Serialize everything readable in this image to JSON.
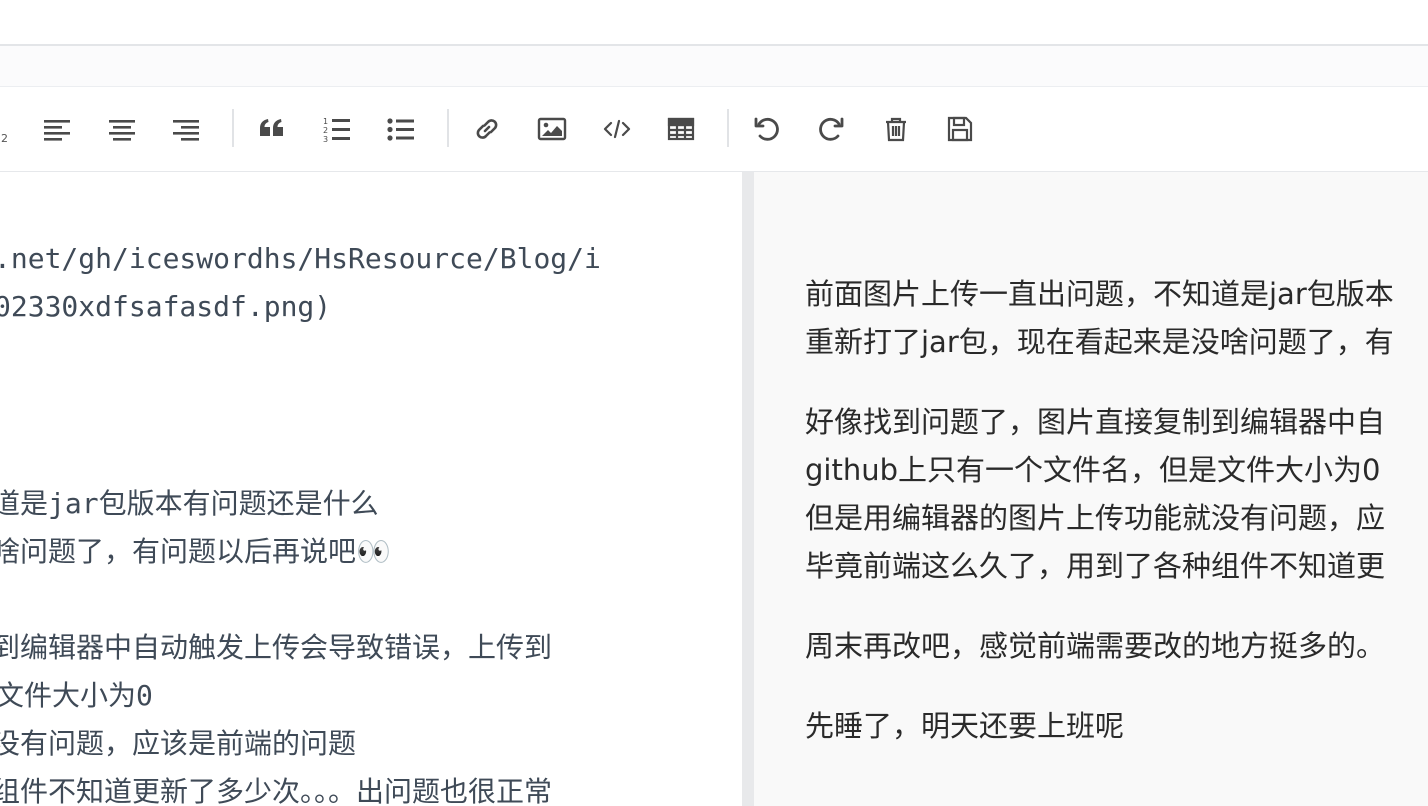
{
  "toolbar": {
    "buttons": [
      {
        "name": "subscript",
        "label": "subscript"
      },
      {
        "name": "align-left",
        "label": "align left"
      },
      {
        "name": "align-center",
        "label": "align center"
      },
      {
        "name": "align-right",
        "label": "align right"
      },
      {
        "name": "quote",
        "label": "quote"
      },
      {
        "name": "ordered-list",
        "label": "ordered list"
      },
      {
        "name": "unordered-list",
        "label": "unordered list"
      },
      {
        "name": "link",
        "label": "link"
      },
      {
        "name": "image",
        "label": "image"
      },
      {
        "name": "code",
        "label": "code"
      },
      {
        "name": "table",
        "label": "table"
      },
      {
        "name": "undo",
        "label": "undo"
      },
      {
        "name": "redo",
        "label": "redo"
      },
      {
        "name": "trash",
        "label": "trash"
      },
      {
        "name": "save",
        "label": "save"
      }
    ]
  },
  "editor": {
    "lines": [
      ".net/gh/iceswordhs/HsResource/Blog/i",
      "02330xdfsafasdf.png)",
      "道是jar包版本有问题还是什么",
      "啥问题了，有问题以后再说吧👀",
      "到编辑器中自动触发上传会导致错误，上传到",
      "文件大小为0",
      "没有问题，应该是前端的问题",
      "组件不知道更新了多少次。。。出问题也很正常"
    ]
  },
  "preview": {
    "paragraphs": [
      "前面图片上传一直出问题，不知道是jar包版本",
      "重新打了jar包，现在看起来是没啥问题了，有",
      "好像找到问题了，图片直接复制到编辑器中自",
      "github上只有一个文件名，但是文件大小为0",
      "但是用编辑器的图片上传功能就没有问题，应",
      "毕竟前端这么久了，用到了各种组件不知道更",
      "周末再改吧，感觉前端需要改的地方挺多的。",
      "先睡了，明天还要上班呢"
    ]
  }
}
